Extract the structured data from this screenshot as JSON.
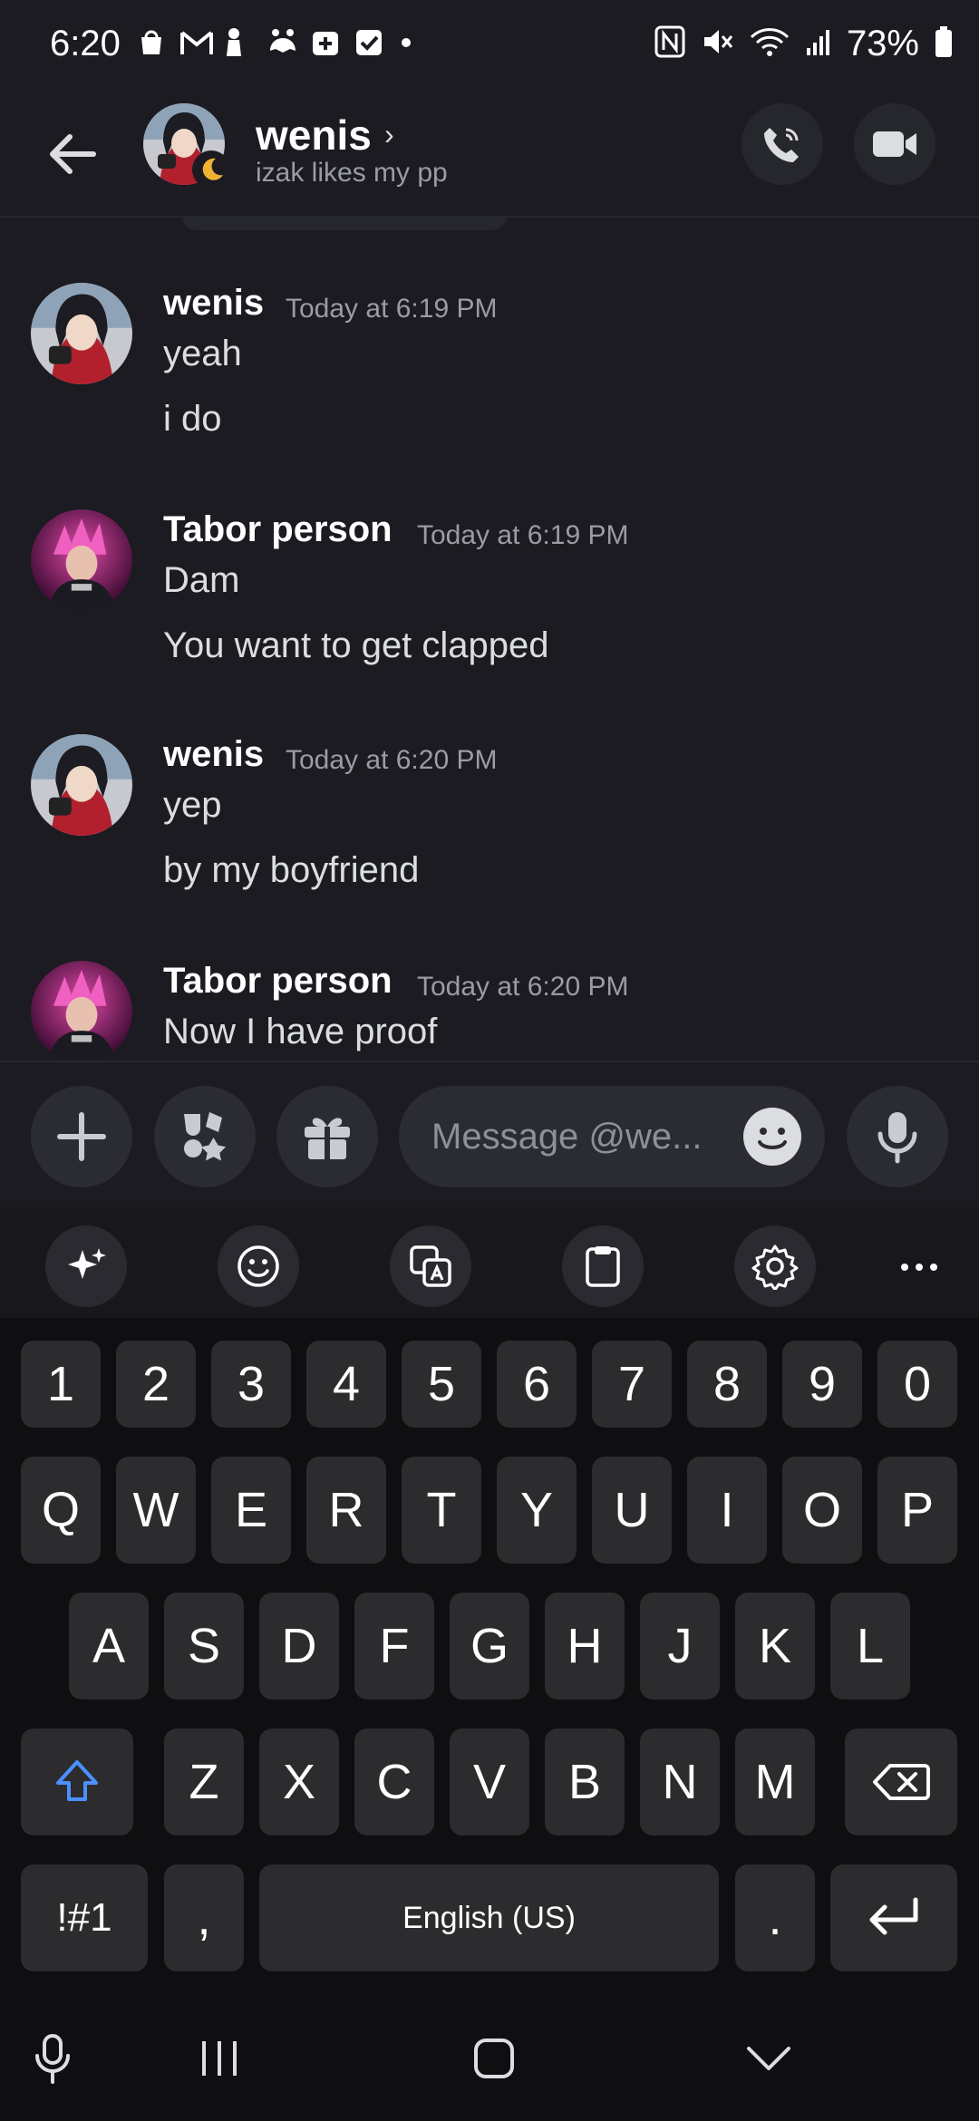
{
  "status_bar": {
    "time": "6:20",
    "battery": "73%"
  },
  "header": {
    "name": "wenis",
    "chevron": "›",
    "status": "izak likes my pp"
  },
  "messages": [
    {
      "author": "wenis",
      "time": "Today at 6:19 PM",
      "lines": [
        "yeah",
        "i do"
      ]
    },
    {
      "author": "Tabor person",
      "time": "Today at 6:19 PM",
      "lines": [
        "Dam",
        "You want to get clapped"
      ]
    },
    {
      "author": "wenis",
      "time": "Today at 6:20 PM",
      "lines": [
        "yep",
        "by my boyfriend"
      ]
    },
    {
      "author": "Tabor person",
      "time": "Today at 6:20 PM",
      "lines": [
        "Now I have proof"
      ]
    }
  ],
  "composer": {
    "placeholder": "Message @we..."
  },
  "keyboard": {
    "row_numbers": [
      "1",
      "2",
      "3",
      "4",
      "5",
      "6",
      "7",
      "8",
      "9",
      "0"
    ],
    "row_top": [
      "Q",
      "W",
      "E",
      "R",
      "T",
      "Y",
      "U",
      "I",
      "O",
      "P"
    ],
    "row_home": [
      "A",
      "S",
      "D",
      "F",
      "G",
      "H",
      "J",
      "K",
      "L"
    ],
    "row_bottom": [
      "Z",
      "X",
      "C",
      "V",
      "B",
      "N",
      "M"
    ],
    "symbols_label": "!#1",
    "comma": ",",
    "space_label": "English (US)",
    "period": "."
  }
}
